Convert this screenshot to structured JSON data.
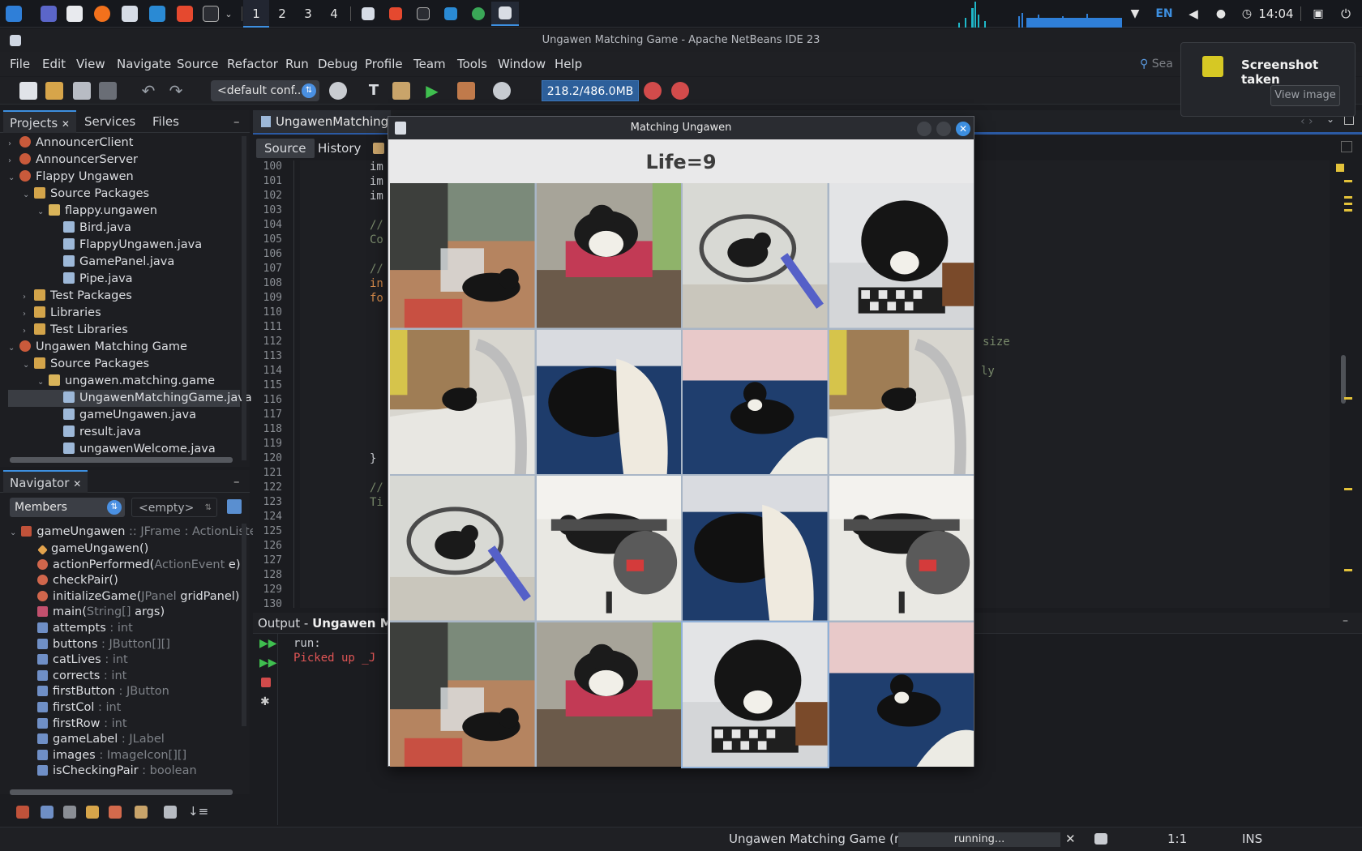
{
  "taskbar": {
    "workspaces": [
      "1",
      "2",
      "3",
      "4"
    ],
    "language": "EN",
    "clock": "14:04"
  },
  "ide": {
    "title": "Ungawen Matching Game - Apache NetBeans IDE 23",
    "menu": [
      "File",
      "Edit",
      "View",
      "Navigate",
      "Source",
      "Refactor",
      "Run",
      "Debug",
      "Profile",
      "Team",
      "Tools",
      "Window",
      "Help"
    ],
    "search_placeholder": "Sea",
    "config": "<default conf...",
    "memory": "218.2/486.0MB"
  },
  "projects": {
    "tabs": [
      "Projects",
      "Services",
      "Files"
    ],
    "tree": [
      {
        "label": "AnnouncerClient",
        "icon": "project-icon",
        "depth": 0,
        "expanded": false
      },
      {
        "label": "AnnouncerServer",
        "icon": "project-icon",
        "depth": 0,
        "expanded": false
      },
      {
        "label": "Flappy Ungawen",
        "icon": "project-icon",
        "depth": 0,
        "expanded": true
      },
      {
        "label": "Source Packages",
        "icon": "folder-icon",
        "depth": 1,
        "expanded": true
      },
      {
        "label": "flappy.ungawen",
        "icon": "package-icon",
        "depth": 2,
        "expanded": true
      },
      {
        "label": "Bird.java",
        "icon": "java-file-icon",
        "depth": 3
      },
      {
        "label": "FlappyUngawen.java",
        "icon": "java-file-icon",
        "depth": 3
      },
      {
        "label": "GamePanel.java",
        "icon": "java-file-icon",
        "depth": 3
      },
      {
        "label": "Pipe.java",
        "icon": "java-file-icon",
        "depth": 3
      },
      {
        "label": "Test Packages",
        "icon": "folder-icon",
        "depth": 1,
        "expanded": false
      },
      {
        "label": "Libraries",
        "icon": "folder-icon",
        "depth": 1,
        "expanded": false
      },
      {
        "label": "Test Libraries",
        "icon": "folder-icon",
        "depth": 1,
        "expanded": false
      },
      {
        "label": "Ungawen Matching Game",
        "icon": "project-icon",
        "depth": 0,
        "expanded": true
      },
      {
        "label": "Source Packages",
        "icon": "folder-icon",
        "depth": 1,
        "expanded": true
      },
      {
        "label": "ungawen.matching.game",
        "icon": "package-icon",
        "depth": 2,
        "expanded": true
      },
      {
        "label": "UngawenMatchingGame.java",
        "icon": "java-file-icon",
        "depth": 3,
        "selected": true
      },
      {
        "label": "gameUngawen.java",
        "icon": "java-file-icon",
        "depth": 3
      },
      {
        "label": "result.java",
        "icon": "java-file-icon",
        "depth": 3
      },
      {
        "label": "ungawenWelcome.java",
        "icon": "java-file-icon",
        "depth": 3
      }
    ]
  },
  "navigator": {
    "title": "Navigator",
    "filter": "Members",
    "secondary": "<empty>",
    "root": {
      "name": "gameUngawen",
      "type": ":: JFrame : ActionListe"
    },
    "members": [
      {
        "name": "gameUngawen()",
        "type": "",
        "kind": "constructor"
      },
      {
        "name": "actionPerformed(",
        "type": "ActionEvent",
        "suffix": " e)",
        "kind": "method-public"
      },
      {
        "name": "checkPair()",
        "type": "",
        "kind": "method"
      },
      {
        "name": "initializeGame(",
        "type": "JPanel",
        "suffix": " gridPanel)",
        "kind": "method"
      },
      {
        "name": "main(",
        "type": "String[]",
        "suffix": " args)",
        "kind": "main"
      },
      {
        "name": "attempts",
        "type": " : int",
        "kind": "field"
      },
      {
        "name": "buttons",
        "type": " : JButton[][]",
        "kind": "field"
      },
      {
        "name": "catLives",
        "type": " : int",
        "kind": "field"
      },
      {
        "name": "corrects",
        "type": " : int",
        "kind": "field"
      },
      {
        "name": "firstButton",
        "type": " : JButton",
        "kind": "field"
      },
      {
        "name": "firstCol",
        "type": " : int",
        "kind": "field"
      },
      {
        "name": "firstRow",
        "type": " : int",
        "kind": "field"
      },
      {
        "name": "gameLabel",
        "type": " : JLabel",
        "kind": "field"
      },
      {
        "name": "images",
        "type": " : ImageIcon[][]",
        "kind": "field"
      },
      {
        "name": "isCheckingPair",
        "type": " : boolean",
        "kind": "field"
      }
    ]
  },
  "editor": {
    "tab_label": "UngawenMatchingG",
    "subtabs": [
      "Source",
      "History"
    ],
    "line_numbers": [
      "100",
      "101",
      "102",
      "103",
      "104",
      "105",
      "106",
      "107",
      "108",
      "109",
      "110",
      "111",
      "112",
      "113",
      "114",
      "115",
      "116",
      "117",
      "118",
      "119",
      "120",
      "121",
      "122",
      "123",
      "124",
      "125",
      "126",
      "127",
      "128",
      "129",
      "130"
    ],
    "code_fragments": {
      "l100": "im",
      "l101": "im",
      "l102": "im",
      "l104": "//",
      "l105": "Co",
      "l107": "//",
      "l108": "in",
      "l109": "fo",
      "l120": "}",
      "l122": "//",
      "l123": "Ti",
      "right1": "size",
      "right2": "ly"
    }
  },
  "output": {
    "title_prefix": "Output - ",
    "title": "Ungawen Matc",
    "lines": [
      "run:",
      "Picked up _J"
    ]
  },
  "statusbar": {
    "task": "Ungawen Matching Game (run)",
    "progress": "running...",
    "position": "1:1",
    "mode": "INS"
  },
  "notification": {
    "title": "Screenshot taken",
    "button": "View image"
  },
  "game": {
    "window_title": "Matching Ungawen",
    "life_label": "Life=9",
    "cards": [
      "cat-balcony-boxes",
      "cat-on-red-chair",
      "cat-in-bike-basket",
      "cat-dark-on-chessboard",
      "cat-under-chair",
      "cat-in-blanket",
      "cat-on-blue-bed",
      "cat-under-chair",
      "cat-in-bike-basket",
      "cat-on-exercise-bike",
      "cat-in-blanket",
      "cat-on-exercise-bike",
      "cat-balcony-boxes",
      "cat-on-red-chair",
      "cat-dark-on-chessboard",
      "cat-on-blue-bed"
    ]
  },
  "colors": {
    "accent": "#3d8fe0",
    "error_text": "#e05555",
    "bg": "#1b1c20"
  }
}
